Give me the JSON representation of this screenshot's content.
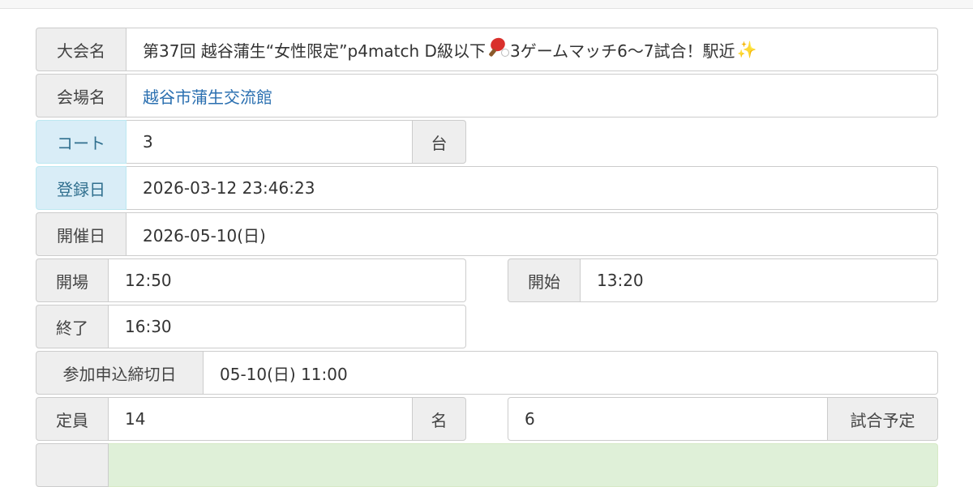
{
  "event": {
    "name_label": "大会名",
    "name_part1": "第37回 越谷蒲生“女性限定”p4match D級以下",
    "name_part2": "3ゲームマッチ6〜7試合！駅近",
    "name_paddle_icon": "ping-pong-paddle-icon",
    "name_sparkle_icon": "sparkles-icon",
    "venue_label": "会場名",
    "venue": "越谷市蒲生交流館",
    "court_label": "コート",
    "court_value": "3",
    "court_unit": "台",
    "registered_label": "登録日",
    "registered_value": "2026-03-12 23:46:23",
    "date_label": "開催日",
    "date_value": "2026-05-10(日)",
    "open_label": "開場",
    "open_value": "12:50",
    "start_label": "開始",
    "start_value": "13:20",
    "end_label": "終了",
    "end_value": "16:30",
    "deadline_label": "参加申込締切日",
    "deadline_value": "05-10(日) 11:00",
    "capacity_label": "定員",
    "capacity_value": "14",
    "capacity_unit": "名",
    "games_value": "6",
    "games_label": "試合予定"
  },
  "colors": {
    "label_bg": "#eeeeee",
    "info_label_bg": "#d9edf7",
    "info_label_text": "#31708f",
    "link": "#2a6fb0",
    "success_bg": "#dff0d8"
  }
}
